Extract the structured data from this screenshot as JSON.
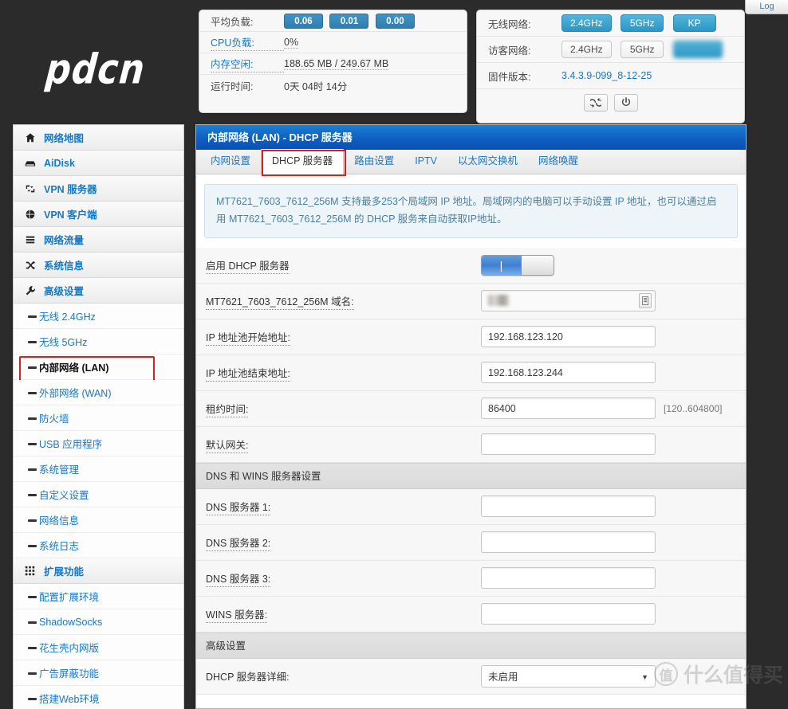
{
  "topbar": {
    "log_label": "Log"
  },
  "brand": {
    "logo_text": "pdcn"
  },
  "status_system": {
    "rows": [
      {
        "label": "平均负载:",
        "type": "badges",
        "badges": [
          "0.06",
          "0.01",
          "0.00"
        ]
      },
      {
        "label": "CPU负载:",
        "type": "text",
        "value": "0%",
        "label_link": true
      },
      {
        "label": "内存空闲:",
        "type": "text",
        "value": "188.65 MB / 249.67 MB",
        "label_link": true
      },
      {
        "label": "运行时间:",
        "type": "text",
        "value": "0天 04时 14分"
      }
    ]
  },
  "status_network": {
    "wireless_label": "无线网络:",
    "wireless_pills": [
      {
        "text": "2.4GHz",
        "state": "on"
      },
      {
        "text": "5GHz",
        "state": "on"
      },
      {
        "text": "KP",
        "state": "on"
      }
    ],
    "guest_label": "访客网络:",
    "guest_pills": [
      {
        "text": "2.4GHz",
        "state": "off"
      },
      {
        "text": "5GHz",
        "state": "off"
      },
      {
        "text": "",
        "state": "blurred"
      }
    ],
    "firmware_label": "固件版本:",
    "firmware_value": "3.4.3.9-099_8-12-25",
    "reboot_icon": "refresh-icon",
    "power_icon": "power-icon"
  },
  "sidebar": {
    "top_items": [
      {
        "label": "网络地图",
        "icon": "home-icon"
      },
      {
        "label": "AiDisk",
        "icon": "disk-icon"
      },
      {
        "label": "VPN 服务器",
        "icon": "vpn-server-icon"
      },
      {
        "label": "VPN 客户端",
        "icon": "globe-icon"
      },
      {
        "label": "网络流量",
        "icon": "traffic-icon"
      },
      {
        "label": "系统信息",
        "icon": "shuffle-icon"
      }
    ],
    "group_advanced": {
      "label": "高级设置",
      "icon": "wrench-icon"
    },
    "advanced_items": [
      {
        "label": "无线 2.4GHz",
        "active": false
      },
      {
        "label": "无线 5GHz",
        "active": false
      },
      {
        "label": "内部网络 (LAN)",
        "active": true
      },
      {
        "label": "外部网络 (WAN)",
        "active": false
      },
      {
        "label": "防火墙",
        "active": false
      },
      {
        "label": "USB 应用程序",
        "active": false
      },
      {
        "label": "系统管理",
        "active": false
      },
      {
        "label": "自定义设置",
        "active": false
      },
      {
        "label": "网络信息",
        "active": false
      },
      {
        "label": "系统日志",
        "active": false
      }
    ],
    "group_extend": {
      "label": "扩展功能",
      "icon": "grid-icon"
    },
    "extend_items": [
      {
        "label": "配置扩展环境"
      },
      {
        "label": "ShadowSocks"
      },
      {
        "label": "花生壳内网版"
      },
      {
        "label": "广告屏蔽功能"
      },
      {
        "label": "搭建Web环境"
      }
    ]
  },
  "main": {
    "title": "内部网络 (LAN) - DHCP 服务器",
    "tabs": [
      {
        "label": "内网设置",
        "selected": false
      },
      {
        "label": "DHCP 服务器",
        "selected": true
      },
      {
        "label": "路由设置",
        "selected": false
      },
      {
        "label": "IPTV",
        "selected": false
      },
      {
        "label": "以太网交换机",
        "selected": false
      },
      {
        "label": "网络唤醒",
        "selected": false
      }
    ],
    "info_text": "MT7621_7603_7612_256M 支持最多253个局域网 IP 地址。局域网内的电脑可以手动设置 IP 地址，也可以通过启用 MT7621_7603_7612_256M 的 DHCP 服务来自动获取IP地址。",
    "fields": [
      {
        "label": "启用 DHCP 服务器",
        "type": "toggle",
        "value": "on",
        "dotted": true
      },
      {
        "label": "MT7621_7603_7612_256M 域名:",
        "type": "text-redacted",
        "value": "",
        "dotted": true,
        "button_icon": "list-icon"
      },
      {
        "label": "IP 地址池开始地址:",
        "type": "text",
        "value": "192.168.123.120",
        "dotted": true
      },
      {
        "label": "IP 地址池结束地址:",
        "type": "text",
        "value": "192.168.123.244",
        "dotted": true
      },
      {
        "label": "租约时间:",
        "type": "text",
        "value": "86400",
        "dotted": true,
        "hint": "[120..604800]"
      },
      {
        "label": "默认网关:",
        "type": "text",
        "value": "",
        "dotted": true
      }
    ],
    "section_dns": "DNS 和 WINS 服务器设置",
    "dns_fields": [
      {
        "label": "DNS 服务器 1:",
        "type": "text",
        "value": "",
        "dotted": true
      },
      {
        "label": "DNS 服务器 2:",
        "type": "text",
        "value": "",
        "dotted": true
      },
      {
        "label": "DNS 服务器 3:",
        "type": "text",
        "value": "",
        "dotted": true
      },
      {
        "label": "WINS 服务器:",
        "type": "text",
        "value": "",
        "dotted": true
      }
    ],
    "section_advanced": "高级设置",
    "advanced_fields": [
      {
        "label": "DHCP 服务器详细:",
        "type": "select",
        "value": "未启用",
        "dotted": false
      }
    ]
  },
  "watermark": {
    "mark": "值",
    "text": "什么值得买"
  }
}
